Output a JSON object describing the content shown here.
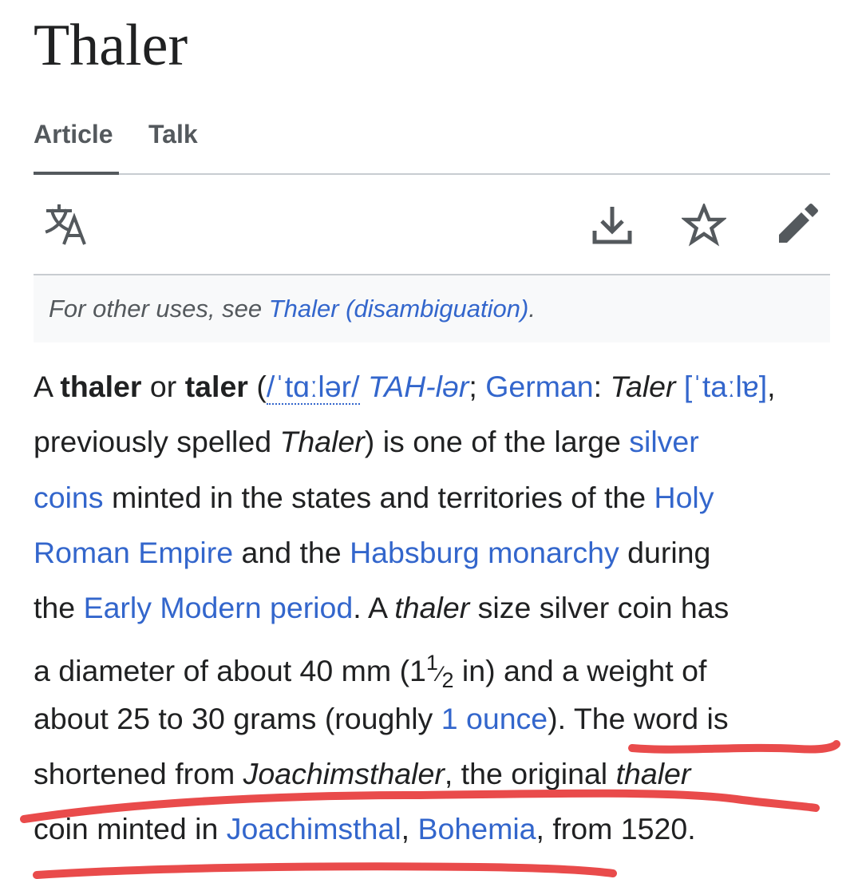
{
  "page": {
    "title": "Thaler"
  },
  "tabs": [
    {
      "label": "Article",
      "active": true
    },
    {
      "label": "Talk",
      "active": false
    }
  ],
  "toolbar": {
    "icons": [
      "language-icon",
      "download-icon",
      "star-icon",
      "edit-pencil-icon"
    ]
  },
  "hatnote": {
    "prefix": "For other uses, see ",
    "link": "Thaler (disambiguation)",
    "suffix": "."
  },
  "paragraph": {
    "l1": {
      "a": "A ",
      "thaler": "thaler",
      "or": " or ",
      "taler": "taler",
      "paren": " (",
      "ipa1": "/ˈtɑːlər/",
      "resp": " TAH-lər",
      "semi": "; ",
      "german": "German",
      "colon": ": ",
      "taler_it": "Taler",
      "sp": " ",
      "ipa2": "[ˈtaːlɐ]",
      "comma": ","
    },
    "l2": {
      "a": "previously spelled ",
      "thaler_it": "Thaler",
      "b": ") is one of the large ",
      "link": "silver"
    },
    "l3": {
      "link": "coins",
      "b": " minted in the states and territories of the ",
      "link2": "Holy"
    },
    "l4": {
      "link": "Roman Empire",
      "b": " and the ",
      "link2": "Habsburg monarchy",
      "c": " during"
    },
    "l5": {
      "a": "the ",
      "link": "Early Modern period",
      "b": ". A ",
      "thaler_it": "thaler",
      "c": " size silver coin has"
    },
    "l6": {
      "a": "a diameter of about 40 mm (1",
      "num": "1",
      "slash": "⁄",
      "den": "2",
      "b": " in) and a weight of"
    },
    "l7": {
      "a": "about 25 to 30 grams (roughly ",
      "link": "1 ounce",
      "b": "). The word is"
    },
    "l8": {
      "a": "shortened from ",
      "joachim_it": "Joachimsthaler",
      "b": ", the original ",
      "thaler_it": "thaler"
    },
    "l9": {
      "a": "coin minted in ",
      "link": "Joachimsthal",
      "comma": ", ",
      "link2": "Bohemia",
      "b": ", from 1520."
    }
  },
  "annotation": {
    "color": "#e94b4b"
  },
  "colors": {
    "link": "#3366cc",
    "text": "#202122",
    "muted": "#54595d",
    "hatnote_bg": "#f8f9fa"
  }
}
